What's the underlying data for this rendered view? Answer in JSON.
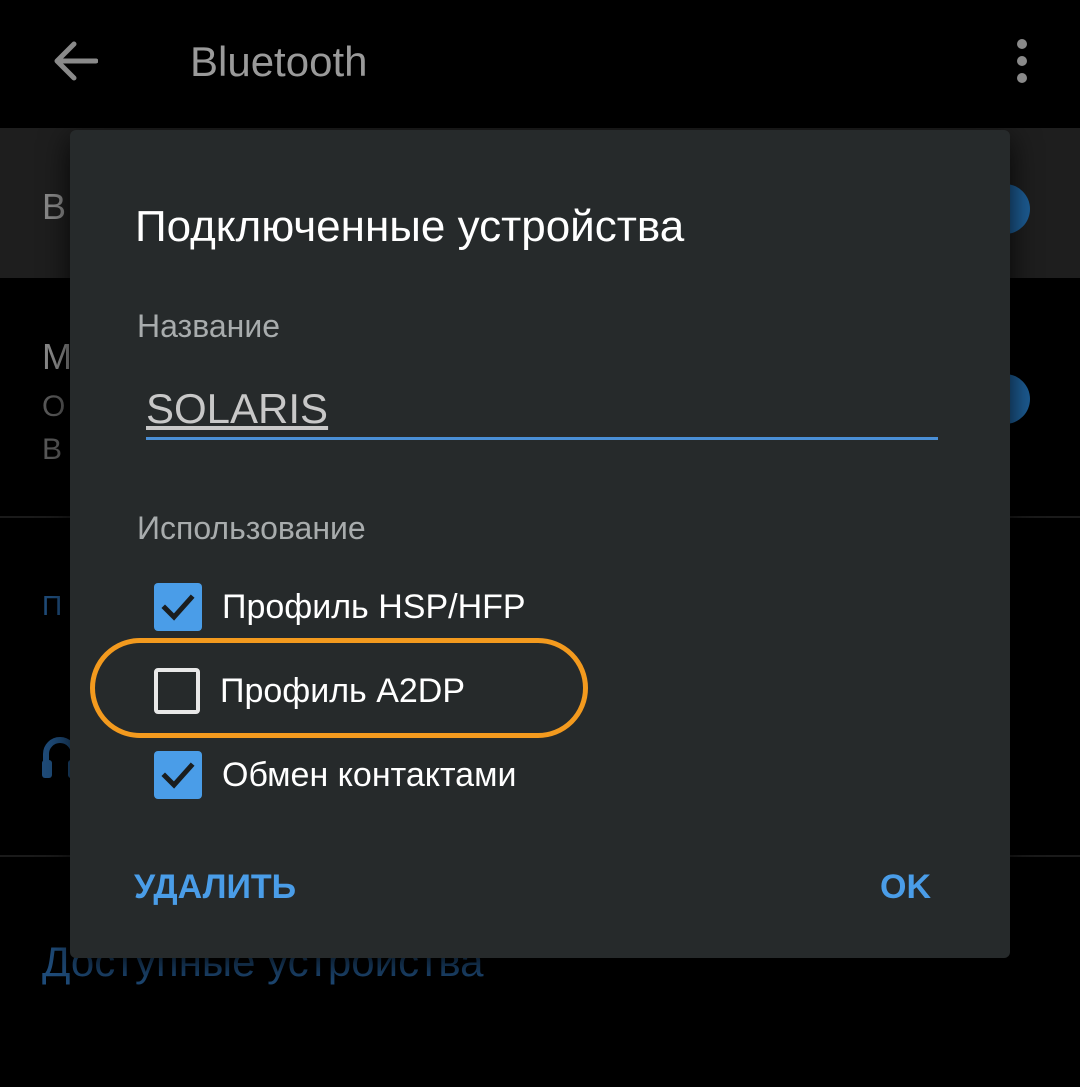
{
  "appbar": {
    "title": "Bluetooth",
    "back_icon": "arrow-left-icon",
    "menu_icon": "more-vertical-icon"
  },
  "background": {
    "bt_row_label": "В",
    "visibility_title": "М",
    "visibility_sub_1": "О",
    "visibility_sub_2": "В",
    "section_link": "П",
    "headphone_icon": "headphones-icon",
    "available_title": "Доступные устройства"
  },
  "dialog": {
    "title": "Подключенные устройства",
    "name_label": "Название",
    "name_value": "SOLARIS",
    "usage_label": "Использование",
    "options": [
      {
        "label": "Профиль HSP/HFP",
        "checked": true
      },
      {
        "label": "Профиль A2DP",
        "checked": false
      },
      {
        "label": "Обмен контактами",
        "checked": true
      }
    ],
    "delete_label": "УДАЛИТЬ",
    "ok_label": "OK"
  },
  "colors": {
    "accent": "#4a9de8",
    "highlight": "#f39a1e",
    "dialog_bg": "#262a2b"
  }
}
